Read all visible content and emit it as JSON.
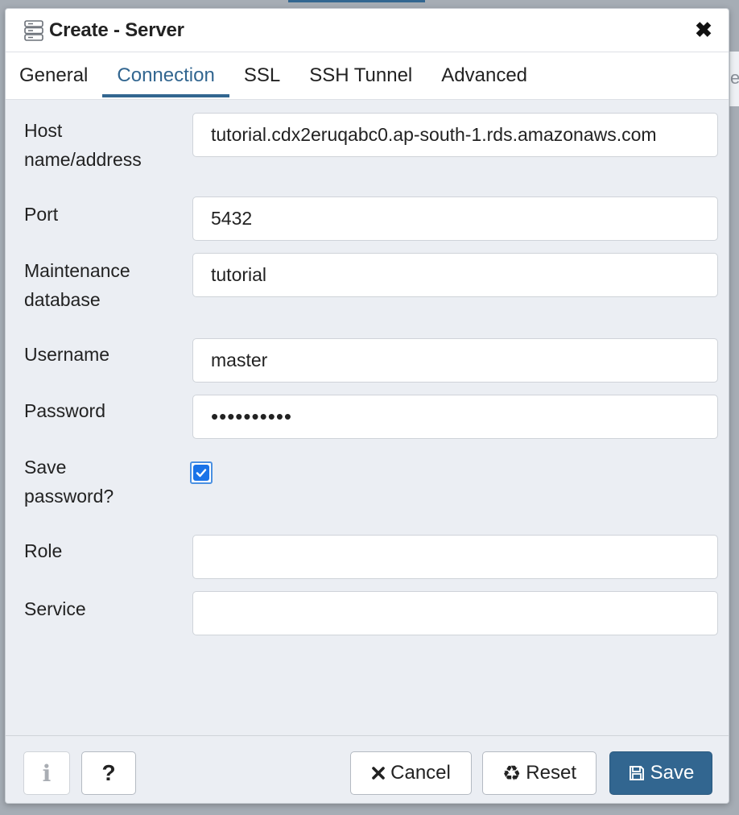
{
  "dialog": {
    "title": "Create - Server",
    "close_icon": "close-icon",
    "title_icon": "server-icon"
  },
  "tabs": [
    {
      "label": "General",
      "active": false
    },
    {
      "label": "Connection",
      "active": true
    },
    {
      "label": "SSL",
      "active": false
    },
    {
      "label": "SSH Tunnel",
      "active": false
    },
    {
      "label": "Advanced",
      "active": false
    }
  ],
  "backdrop": {
    "peek_text": "e"
  },
  "form": {
    "host": {
      "label_line1": "Host",
      "label_line2": "name/address",
      "value": "tutorial.cdx2eruqabc0.ap-south-1.rds.amazonaws.com"
    },
    "port": {
      "label": "Port",
      "value": "5432"
    },
    "maintenance_db": {
      "label_line1": "Maintenance",
      "label_line2": "database",
      "value": "tutorial"
    },
    "username": {
      "label": "Username",
      "value": "master"
    },
    "password": {
      "label": "Password",
      "value": "••••••••••"
    },
    "save_password": {
      "label_line1": "Save",
      "label_line2": "password?",
      "checked": true
    },
    "role": {
      "label": "Role",
      "value": ""
    },
    "service": {
      "label": "Service",
      "value": ""
    }
  },
  "footer": {
    "info_label": "i",
    "help_label": "?",
    "cancel_label": "Cancel",
    "reset_label": "Reset",
    "save_label": "Save"
  },
  "colors": {
    "accent": "#326690",
    "checkbox": "#1a73e8",
    "panel_bg": "#ebeef3"
  }
}
